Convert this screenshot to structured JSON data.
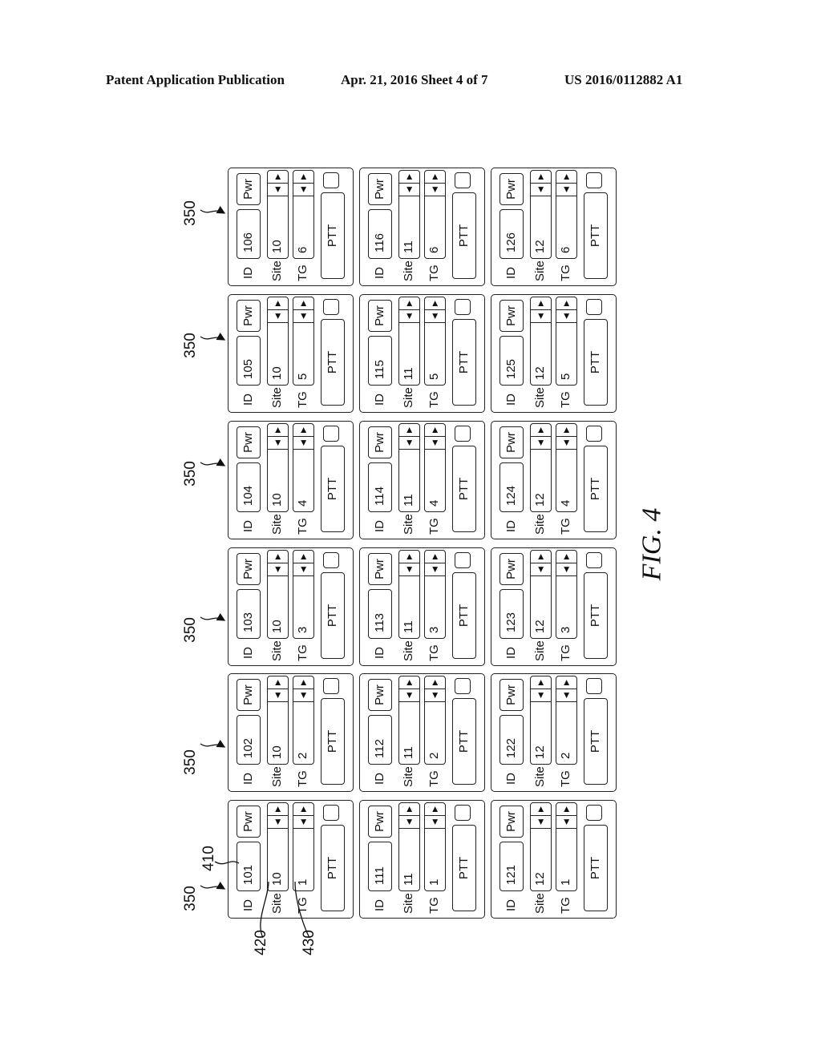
{
  "header": {
    "left": "Patent Application Publication",
    "center": "Apr. 21, 2016  Sheet 4 of 7",
    "right": "US 2016/0112882 A1"
  },
  "figure_label": "FIG. 4",
  "labels": {
    "id": "ID",
    "site": "Site",
    "tg": "TG",
    "pwr": "Pwr",
    "ptt": "PTT"
  },
  "reference_numerals": {
    "panel": "350",
    "id_field": "410",
    "site_field": "420",
    "tg_field": "430"
  },
  "columns": [
    {
      "panels": [
        {
          "id": "101",
          "site": "10",
          "tg": "1"
        },
        {
          "id": "102",
          "site": "10",
          "tg": "2"
        },
        {
          "id": "103",
          "site": "10",
          "tg": "3"
        },
        {
          "id": "104",
          "site": "10",
          "tg": "4"
        },
        {
          "id": "105",
          "site": "10",
          "tg": "5"
        },
        {
          "id": "106",
          "site": "10",
          "tg": "6"
        }
      ]
    },
    {
      "panels": [
        {
          "id": "111",
          "site": "11",
          "tg": "1"
        },
        {
          "id": "112",
          "site": "11",
          "tg": "2"
        },
        {
          "id": "113",
          "site": "11",
          "tg": "3"
        },
        {
          "id": "114",
          "site": "11",
          "tg": "4"
        },
        {
          "id": "115",
          "site": "11",
          "tg": "5"
        },
        {
          "id": "116",
          "site": "11",
          "tg": "6"
        }
      ]
    },
    {
      "panels": [
        {
          "id": "121",
          "site": "12",
          "tg": "1"
        },
        {
          "id": "122",
          "site": "12",
          "tg": "2"
        },
        {
          "id": "123",
          "site": "12",
          "tg": "3"
        },
        {
          "id": "124",
          "site": "12",
          "tg": "4"
        },
        {
          "id": "125",
          "site": "12",
          "tg": "5"
        },
        {
          "id": "126",
          "site": "12",
          "tg": "6"
        }
      ]
    }
  ]
}
